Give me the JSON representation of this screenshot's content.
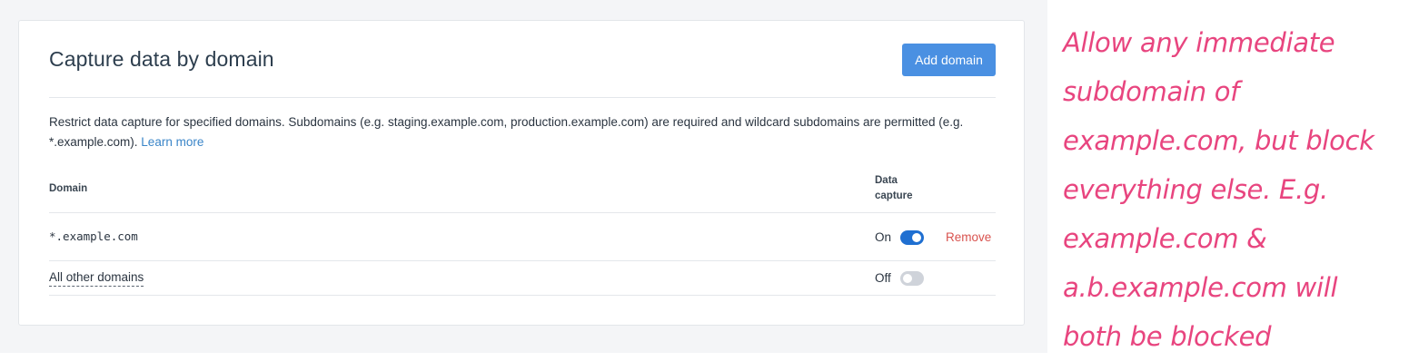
{
  "panel": {
    "title": "Capture data by domain",
    "add_button_label": "Add domain",
    "description": "Restrict data capture for specified domains. Subdomains (e.g. staging.example.com, production.example.com) are required and wildcard subdomains are permitted (e.g. *.example.com).",
    "learn_more_label": "Learn more"
  },
  "table": {
    "columns": {
      "domain": "Domain",
      "data_capture": "Data capture"
    },
    "rows": [
      {
        "domain": "*.example.com",
        "status": "On",
        "enabled": true,
        "remove_label": "Remove"
      },
      {
        "domain": "All other domains",
        "status": "Off",
        "enabled": false
      }
    ]
  },
  "annotation": {
    "lines": [
      "Allow any immediate",
      "subdomain of",
      "example.com, but block",
      "everything else. E.g.",
      "example.com &",
      "a.b.example.com will",
      "both be blocked"
    ],
    "color": "#e8457f"
  },
  "colors": {
    "accent": "#4a90e2",
    "toggle_on": "#1f6fd1",
    "toggle_off": "#cfd3da",
    "remove": "#d9534f",
    "link": "#3a85c8"
  }
}
